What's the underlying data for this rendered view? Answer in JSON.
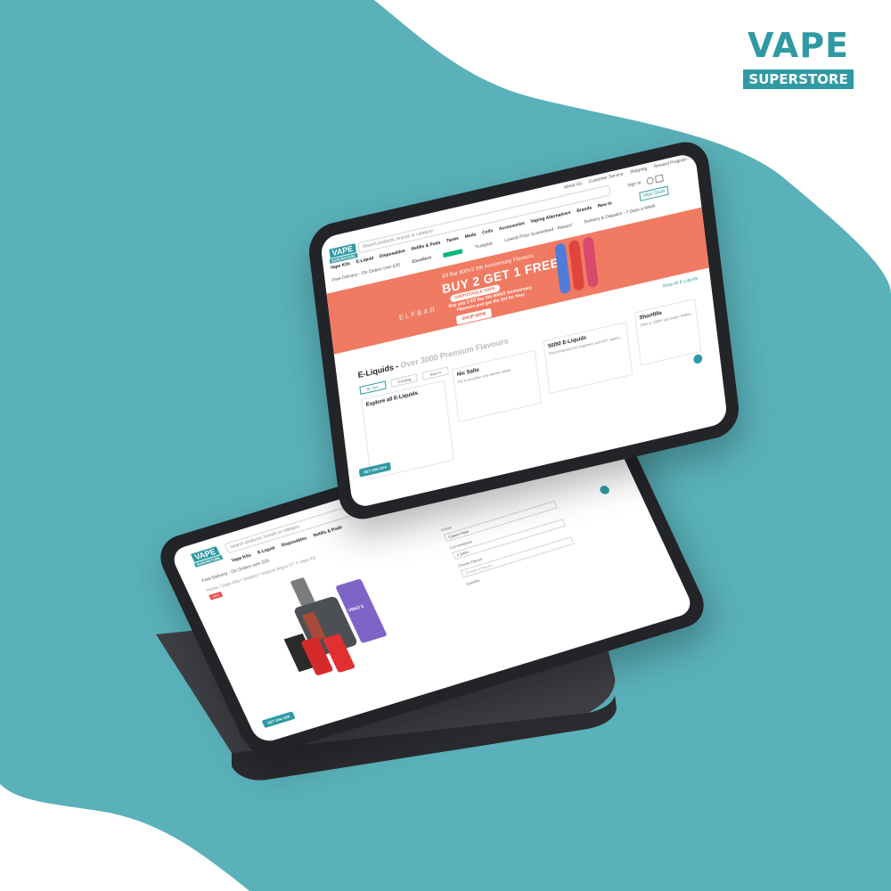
{
  "brand": {
    "logo_top": "VAPE",
    "logo_bottom": "SUPERSTORE",
    "teal": "#5ab1ba",
    "accent": "#2f9aa3"
  },
  "front_screen": {
    "top_links": [
      "About Us",
      "Customer Service",
      "Shipping",
      "Reward Program"
    ],
    "search_placeholder": "Search products, brands or category",
    "account": "Sign In",
    "nav": [
      "Vape Kits",
      "E-Liquid",
      "Disposables",
      "Refills & Pods",
      "Tanks",
      "Mods",
      "Coils",
      "Accessories",
      "Vaping Alternatives",
      "Brands",
      "New In"
    ],
    "vape_deals": "Vape Deals",
    "free_delivery": "Free Delivery - On Orders over £20",
    "trustpilot": "Excellent",
    "trustpilot_brand": "Trustpilot",
    "price_guarantee": "Lowest Price Guaranteed - Always!",
    "delivery_dispatch": "Delivery & Dispatch - 7 Days a Week",
    "hero": {
      "subtitle": "Elf Bar 600V2 5th Anniversary Flavours",
      "headline": "BUY 2 GET 1 FREE",
      "pill": "DISPOSABLE VAPE",
      "body": "Buy any 2 Elf Bar 5th 600V2 Anniversary Flavours and get the 3rd for free!",
      "cta": "SHOP NOW",
      "brand": "ELFBAR"
    },
    "shop_all": "Shop All E-Liquids",
    "section_title": "E-Liquids -",
    "section_sub": "Over 3000 Premium Flavours",
    "tabs": [
      "By Type",
      "Trending",
      "New In"
    ],
    "cards": [
      {
        "title": "Explore all E-Liquids.",
        "sub": ""
      },
      {
        "title": "Nic Salts",
        "sub": "For a smoother and intense inhale."
      },
      {
        "title": "50/50 E-Liquids",
        "sub": "Recommended for beginners and MTL vapers."
      },
      {
        "title": "Shortfills",
        "sub": "50ml or 100ml, get longer bottles."
      }
    ],
    "discount": "GET 10% OFF"
  },
  "back_screen": {
    "search_placeholder": "Search products, brands or category",
    "nav": [
      "Vape Kits",
      "E-Liquid",
      "Disposables",
      "Refills & Pods"
    ],
    "free_delivery": "Free Delivery - On Orders over £20",
    "breadcrumb": "Home / Vape Kits / Voopoo / Voopoo Argus GT II Vape Kit",
    "sale": "SAVE",
    "labels": [
      "Colour",
      "Coil resistance",
      "Choose Flavour",
      "Quantity"
    ],
    "values": [
      "Carbon Fibre",
      "0.2ohm",
      "Choose a Flavour"
    ],
    "discount": "GET 10% OFF",
    "product_text": "VINCI 3"
  }
}
